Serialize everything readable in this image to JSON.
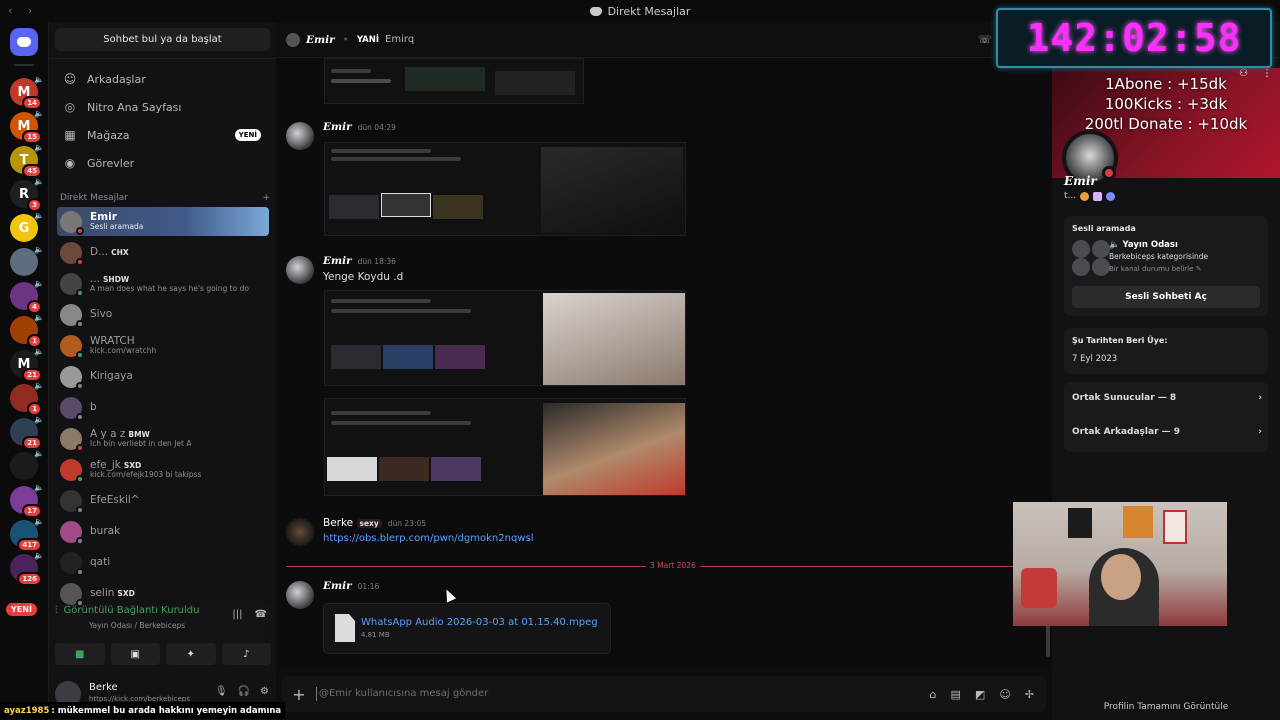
{
  "window": {
    "title": "Direkt Mesajlar"
  },
  "colors": {
    "accent": "#5865f2",
    "danger": "#e63d3d",
    "online": "#43a25a",
    "link": "#5aa0ff",
    "timer": "#ff2dff"
  },
  "servers": [
    {
      "letter": "M",
      "badge": "14",
      "color": "#c0392b"
    },
    {
      "letter": "M",
      "badge": "15",
      "color": "#d35400"
    },
    {
      "letter": "T",
      "badge": "45",
      "color": "#b7950b"
    },
    {
      "letter": "R",
      "badge": "3",
      "color": "#1f1f1f"
    },
    {
      "letter": "G",
      "badge": "",
      "color": "#f1c40f"
    },
    {
      "letter": "",
      "badge": "",
      "color": "#5d6d7e"
    },
    {
      "letter": "",
      "badge": "4",
      "color": "#6c3483"
    },
    {
      "letter": "",
      "badge": "1",
      "color": "#a04000"
    },
    {
      "letter": "M",
      "badge": "21",
      "color": "#1c1c1c"
    },
    {
      "letter": "",
      "badge": "1",
      "color": "#922b21"
    },
    {
      "letter": "",
      "badge": "21",
      "color": "#2e4053"
    },
    {
      "letter": "",
      "badge": "",
      "color": "#1c1c1c"
    },
    {
      "letter": "",
      "badge": "17",
      "color": "#7d3c98"
    },
    {
      "letter": "",
      "badge": "417",
      "color": "#1a5276"
    },
    {
      "letter": "",
      "badge": "126",
      "color": "#4a235a"
    }
  ],
  "rail": {
    "new_pill": "YENİ"
  },
  "sidebar": {
    "search": "Sohbet bul ya da başlat",
    "nav": [
      {
        "label": "Arkadaşlar",
        "icon": "friends-icon",
        "glyph": "☺"
      },
      {
        "label": "Nitro Ana Sayfası",
        "icon": "nitro-icon",
        "glyph": "◎"
      },
      {
        "label": "Mağaza",
        "icon": "shop-icon",
        "glyph": "▦",
        "badge": "YENİ"
      },
      {
        "label": "Görevler",
        "icon": "quests-icon",
        "glyph": "◉"
      }
    ],
    "dm_header": "Direkt Mesajlar",
    "dm_add": "+",
    "dms": [
      {
        "name": "Emir",
        "sub": "Sesli aramada",
        "active": true,
        "status": "#e03c46",
        "avatar": "#777"
      },
      {
        "name": "D...",
        "tag": "CHX",
        "sub": "",
        "status": "#e03c46",
        "avatar": "#6b4a3a"
      },
      {
        "name": "...",
        "tag": "SHDW",
        "sub": "A man does what he says he's going to do",
        "status": "#43a25a",
        "avatar": "#444"
      },
      {
        "name": "Sivo",
        "sub": "",
        "status": "#80848e",
        "avatar": "#888"
      },
      {
        "name": "WRATCH",
        "sub": "kick.com/wratchh",
        "status": "#43a25a",
        "avatar": "#b35a1f"
      },
      {
        "name": "Kirigaya",
        "sub": "",
        "status": "#80848e",
        "avatar": "#999"
      },
      {
        "name": "b",
        "sub": "",
        "status": "#80848e",
        "avatar": "#5a4a6a"
      },
      {
        "name": "A y a z",
        "tag": "BMW",
        "sub": "Ich bin verliebt in den Jet A",
        "status": "#e03c46",
        "avatar": "#8a7a6a"
      },
      {
        "name": "efe_jk",
        "tag": "SXD",
        "sub": "kick.com/efejk1903 bi takipss",
        "status": "#43a25a",
        "avatar": "#c0392b"
      },
      {
        "name": "EfeEskil^",
        "sub": "",
        "status": "#80848e",
        "avatar": "#333"
      },
      {
        "name": "burak",
        "sub": "",
        "status": "#80848e",
        "avatar": "#a24a8a"
      },
      {
        "name": "qati",
        "sub": "",
        "status": "#80848e",
        "avatar": "#222"
      },
      {
        "name": "selin",
        "tag": "SXD",
        "sub": "",
        "status": "#80848e",
        "avatar": "#555"
      }
    ]
  },
  "voice": {
    "title": "Görüntülü Bağlantı Kuruldu",
    "subtitle": "Yayın Odası / Berkebiceps"
  },
  "user": {
    "name": "Berke",
    "status": "https://kick.com/berkebiceps"
  },
  "header": {
    "name": "Emir",
    "badge": "YANİ",
    "alias": "Emirq"
  },
  "timer": "142:02:58",
  "goals": [
    "1Abone : +15dk",
    "100Kicks : +3dk",
    "200tl Donate : +10dk"
  ],
  "messages": [
    {
      "author": "Emir",
      "time": "dün 04:29",
      "text": ""
    },
    {
      "author": "Emir",
      "time": "dün 18:36",
      "text": "Yenge Koydu .d"
    },
    {
      "author": "Berke",
      "tag": "sexy",
      "time": "dün 23:05",
      "link": "https://obs.blerp.com/pwn/dgmokn2nqwsl"
    },
    {
      "author": "Emir",
      "time": "01:16",
      "text": ""
    }
  ],
  "date_divider": "3 Mart 2026",
  "attachment": {
    "name": "WhatsApp Audio 2026-03-03 at 01.15.40.mpeg",
    "size": "4.81 MB"
  },
  "composer": {
    "placeholder": "@Emir kullanıcısına mesaj gönder"
  },
  "profile": {
    "name": "Emir",
    "status": "t...",
    "voice_header": "Sesli aramada",
    "voice_channel": "Yayın Odası",
    "voice_category": "Berkebiceps kategorisinde",
    "voice_set_status": "Bir kanal durumu belirle",
    "join_button": "Sesli Sohbeti Aç",
    "member_since_label": "Şu Tarihten Beri Üye:",
    "member_since": "7 Eyl 2023",
    "mutual_servers": "Ortak Sunucular — 8",
    "mutual_friends": "Ortak Arkadaşlar — 9",
    "view_full": "Profilin Tamamını Görüntüle"
  },
  "stream_chat": {
    "user": "ayaz1985",
    "text": ": mükemmel bu arada hakkını yemeyin adamına"
  }
}
